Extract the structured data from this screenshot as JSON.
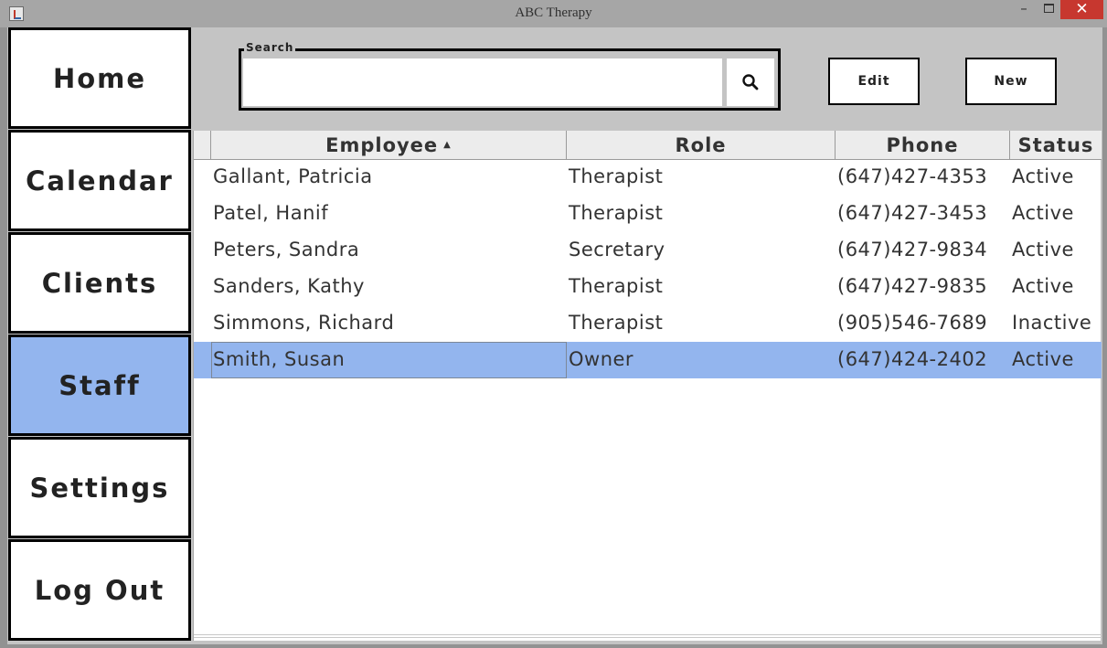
{
  "window": {
    "title": "ABC Therapy",
    "minimize": "–",
    "close": "✕"
  },
  "sidebar": {
    "items": [
      {
        "label": "Home",
        "active": false
      },
      {
        "label": "Calendar",
        "active": false
      },
      {
        "label": "Clients",
        "active": false
      },
      {
        "label": "Staff",
        "active": true
      },
      {
        "label": "Settings",
        "active": false
      },
      {
        "label": "Log Out",
        "active": false
      }
    ]
  },
  "search": {
    "legend": "Search",
    "value": "",
    "icon": "search-icon"
  },
  "toolbar": {
    "edit_label": "Edit",
    "new_label": "New"
  },
  "table": {
    "columns": [
      "Employee",
      "Role",
      "Phone",
      "Status"
    ],
    "sort_indicator": "▲",
    "rows": [
      {
        "employee": "Gallant, Patricia",
        "role": "Therapist",
        "phone": "(647)427-4353",
        "status": "Active"
      },
      {
        "employee": "Patel, Hanif",
        "role": "Therapist",
        "phone": "(647)427-3453",
        "status": "Active"
      },
      {
        "employee": "Peters, Sandra",
        "role": "Secretary",
        "phone": "(647)427-9834",
        "status": "Active"
      },
      {
        "employee": "Sanders, Kathy",
        "role": "Therapist",
        "phone": "(647)427-9835",
        "status": "Active"
      },
      {
        "employee": "Simmons, Richard",
        "role": "Therapist",
        "phone": "(905)546-7689",
        "status": "Inactive"
      },
      {
        "employee": "Smith, Susan",
        "role": "Owner",
        "phone": "(647)424-2402",
        "status": "Active"
      }
    ],
    "selected_row": 5
  },
  "colors": {
    "accent": "#93b5ee",
    "frame": "#c4c4c4",
    "close": "#c7372f"
  }
}
